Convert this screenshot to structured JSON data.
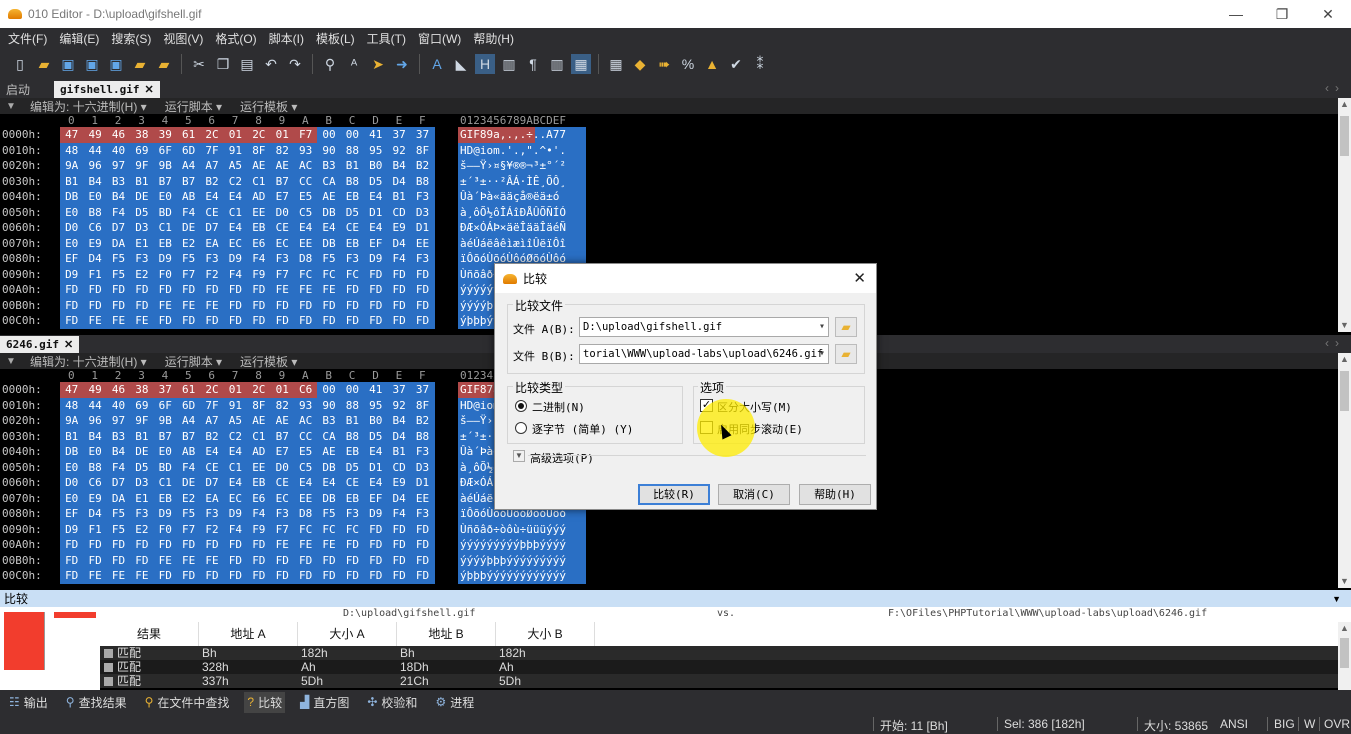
{
  "window": {
    "title": "010 Editor - D:\\upload\\gifshell.gif",
    "minimize": "—",
    "restore": "❐",
    "close": "✕"
  },
  "menu": [
    "文件(F)",
    "编辑(E)",
    "搜索(S)",
    "视图(V)",
    "格式(O)",
    "脚本(I)",
    "模板(L)",
    "工具(T)",
    "窗口(W)",
    "帮助(H)"
  ],
  "tabs_top": {
    "start": "启动",
    "file": "gifshell.gif",
    "close": "✕"
  },
  "tabs_bottom": {
    "file": "6246.gif",
    "close": "✕"
  },
  "editor_options": {
    "edit_as": "编辑为: 十六进制(H) ▾",
    "run_script": "运行脚本 ▾",
    "run_template": "运行模板 ▾"
  },
  "hex_header": {
    "columns": [
      "0",
      "1",
      "2",
      "3",
      "4",
      "5",
      "6",
      "7",
      "8",
      "9",
      "A",
      "B",
      "C",
      "D",
      "E",
      "F"
    ],
    "ascii": "0123456789ABCDEF"
  },
  "pane_a": {
    "lines": [
      {
        "offset": "0000h:",
        "bytes": [
          "47",
          "49",
          "46",
          "38",
          "39",
          "61",
          "2C",
          "01",
          "2C",
          "01",
          "F7",
          "00",
          "00",
          "41",
          "37",
          "37"
        ],
        "ascii": "GIF89a,.,.÷..A77"
      },
      {
        "offset": "0010h:",
        "bytes": [
          "48",
          "44",
          "40",
          "69",
          "6F",
          "6D",
          "7F",
          "91",
          "8F",
          "82",
          "93",
          "90",
          "88",
          "95",
          "92",
          "8F"
        ],
        "ascii": "HD@iom.'.,\".^•'."
      },
      {
        "offset": "0020h:",
        "bytes": [
          "9A",
          "96",
          "97",
          "9F",
          "9B",
          "A4",
          "A7",
          "A5",
          "AE",
          "AE",
          "AC",
          "B3",
          "B1",
          "B0",
          "B4",
          "B2"
        ],
        "ascii": "š–—Ÿ›¤§¥®®¬³±°´²"
      },
      {
        "offset": "0030h:",
        "bytes": [
          "B1",
          "B4",
          "B3",
          "B1",
          "B7",
          "B7",
          "B2",
          "C2",
          "C1",
          "B7",
          "CC",
          "CA",
          "B8",
          "D5",
          "D4",
          "B8"
        ],
        "ascii": "±´³±··²ÂÁ·ÌÊ¸ÕÔ¸"
      },
      {
        "offset": "0040h:",
        "bytes": [
          "DB",
          "E0",
          "B4",
          "DE",
          "E0",
          "AB",
          "E4",
          "E4",
          "AD",
          "E7",
          "E5",
          "AE",
          "EB",
          "E4",
          "B1",
          "F3"
        ],
        "ascii": "Ûà´Þà«ää­çå®ëä±ó"
      },
      {
        "offset": "0050h:",
        "bytes": [
          "E0",
          "B8",
          "F4",
          "D5",
          "BD",
          "F4",
          "CE",
          "C1",
          "EE",
          "D0",
          "C5",
          "DB",
          "D5",
          "D1",
          "CD",
          "D3"
        ],
        "ascii": "à¸ôÕ½ôÎÁîÐÅÛÕÑÍÓ"
      },
      {
        "offset": "0060h:",
        "bytes": [
          "D0",
          "C6",
          "D7",
          "D3",
          "C1",
          "DE",
          "D7",
          "E4",
          "EB",
          "CE",
          "E4",
          "E4",
          "CE",
          "E4",
          "E9",
          "D1"
        ],
        "ascii": "ÐÆ×ÓÁÞ×äëÎääÎäéÑ"
      },
      {
        "offset": "0070h:",
        "bytes": [
          "E0",
          "E9",
          "DA",
          "E1",
          "EB",
          "E2",
          "EA",
          "EC",
          "E6",
          "EC",
          "EE",
          "DB",
          "EB",
          "EF",
          "D4",
          "EE"
        ],
        "ascii": "àéÚáëâêìæìîÛëïÔî"
      },
      {
        "offset": "0080h:",
        "bytes": [
          "EF",
          "D4",
          "F5",
          "F3",
          "D9",
          "F5",
          "F3",
          "D9",
          "F4",
          "F3",
          "D8",
          "F5",
          "F3",
          "D9",
          "F4",
          "F3"
        ],
        "ascii": "ïÔõóÙõóÙôóØõóÙôó"
      },
      {
        "offset": "0090h:",
        "bytes": [
          "D9",
          "F1",
          "F5",
          "E2",
          "F0",
          "F7",
          "F2",
          "F4",
          "F9",
          "F7",
          "FC",
          "FC",
          "FC",
          "FD",
          "FD",
          "FD"
        ],
        "ascii": "Ùñõâð÷òôù÷üüüýýý"
      },
      {
        "offset": "00A0h:",
        "bytes": [
          "FD",
          "FD",
          "FD",
          "FD",
          "FD",
          "FD",
          "FD",
          "FD",
          "FD",
          "FE",
          "FE",
          "FE",
          "FD",
          "FD",
          "FD",
          "FD"
        ],
        "ascii": "ýýýýýýýýýþþþýýýý"
      },
      {
        "offset": "00B0h:",
        "bytes": [
          "FD",
          "FD",
          "FD",
          "FD",
          "FE",
          "FE",
          "FE",
          "FD",
          "FD",
          "FD",
          "FD",
          "FD",
          "FD",
          "FD",
          "FD",
          "FD"
        ],
        "ascii": "ýýýýþþþýýýýýýýýý"
      },
      {
        "offset": "00C0h:",
        "bytes": [
          "FD",
          "FE",
          "FE",
          "FE",
          "FD",
          "FD",
          "FD",
          "FD",
          "FD",
          "FD",
          "FD",
          "FD",
          "FD",
          "FD",
          "FD",
          "FD"
        ],
        "ascii": "ýþþþýýýýýýýýýýýý"
      }
    ]
  },
  "pane_b": {
    "lines": [
      {
        "offset": "0000h:",
        "bytes": [
          "47",
          "49",
          "46",
          "38",
          "37",
          "61",
          "2C",
          "01",
          "2C",
          "01",
          "C6",
          "00",
          "00",
          "41",
          "37",
          "37"
        ],
        "ascii": "GIF87a,.,.Æ..A77"
      },
      {
        "offset": "0010h:",
        "bytes": [
          "48",
          "44",
          "40",
          "69",
          "6F",
          "6D",
          "7F",
          "91",
          "8F",
          "82",
          "93",
          "90",
          "88",
          "95",
          "92",
          "8F"
        ],
        "ascii": "HD@iom.'.,\".^•'."
      },
      {
        "offset": "0020h:",
        "bytes": [
          "9A",
          "96",
          "97",
          "9F",
          "9B",
          "A4",
          "A7",
          "A5",
          "AE",
          "AE",
          "AC",
          "B3",
          "B1",
          "B0",
          "B4",
          "B2"
        ],
        "ascii": "š–—Ÿ›¤§¥®®¬³±°´²"
      },
      {
        "offset": "0030h:",
        "bytes": [
          "B1",
          "B4",
          "B3",
          "B1",
          "B7",
          "B7",
          "B2",
          "C2",
          "C1",
          "B7",
          "CC",
          "CA",
          "B8",
          "D5",
          "D4",
          "B8"
        ],
        "ascii": "±´³±··²ÂÁ·ÌÊ¸ÕÔ¸"
      },
      {
        "offset": "0040h:",
        "bytes": [
          "DB",
          "E0",
          "B4",
          "DE",
          "E0",
          "AB",
          "E4",
          "E4",
          "AD",
          "E7",
          "E5",
          "AE",
          "EB",
          "E4",
          "B1",
          "F3"
        ],
        "ascii": "Ûà´Þà«ää­çå®ëä±ó"
      },
      {
        "offset": "0050h:",
        "bytes": [
          "E0",
          "B8",
          "F4",
          "D5",
          "BD",
          "F4",
          "CE",
          "C1",
          "EE",
          "D0",
          "C5",
          "DB",
          "D5",
          "D1",
          "CD",
          "D3"
        ],
        "ascii": "à¸ôÕ½ôÎÁîÐÅÛÕÑÍÓ"
      },
      {
        "offset": "0060h:",
        "bytes": [
          "D0",
          "C6",
          "D7",
          "D3",
          "C1",
          "DE",
          "D7",
          "E4",
          "EB",
          "CE",
          "E4",
          "E4",
          "CE",
          "E4",
          "E9",
          "D1"
        ],
        "ascii": "ÐÆ×ÓÁÞ×äëÎääÎäéÑ"
      },
      {
        "offset": "0070h:",
        "bytes": [
          "E0",
          "E9",
          "DA",
          "E1",
          "EB",
          "E2",
          "EA",
          "EC",
          "E6",
          "EC",
          "EE",
          "DB",
          "EB",
          "EF",
          "D4",
          "EE"
        ],
        "ascii": "àéÚáëâêìæìîÛëïÔî"
      },
      {
        "offset": "0080h:",
        "bytes": [
          "EF",
          "D4",
          "F5",
          "F3",
          "D9",
          "F5",
          "F3",
          "D9",
          "F4",
          "F3",
          "D8",
          "F5",
          "F3",
          "D9",
          "F4",
          "F3"
        ],
        "ascii": "ïÔõóÙõóÙôóØõóÙôó"
      },
      {
        "offset": "0090h:",
        "bytes": [
          "D9",
          "F1",
          "F5",
          "E2",
          "F0",
          "F7",
          "F2",
          "F4",
          "F9",
          "F7",
          "FC",
          "FC",
          "FC",
          "FD",
          "FD",
          "FD"
        ],
        "ascii": "Ùñõâð÷òôù÷üüüýýý"
      },
      {
        "offset": "00A0h:",
        "bytes": [
          "FD",
          "FD",
          "FD",
          "FD",
          "FD",
          "FD",
          "FD",
          "FD",
          "FD",
          "FE",
          "FE",
          "FE",
          "FD",
          "FD",
          "FD",
          "FD"
        ],
        "ascii": "ýýýýýýýýýþþþýýýý"
      },
      {
        "offset": "00B0h:",
        "bytes": [
          "FD",
          "FD",
          "FD",
          "FD",
          "FE",
          "FE",
          "FE",
          "FD",
          "FD",
          "FD",
          "FD",
          "FD",
          "FD",
          "FD",
          "FD",
          "FD"
        ],
        "ascii": "ýýýýþþþýýýýýýýýý"
      },
      {
        "offset": "00C0h:",
        "bytes": [
          "FD",
          "FE",
          "FE",
          "FE",
          "FD",
          "FD",
          "FD",
          "FD",
          "FD",
          "FD",
          "FD",
          "FD",
          "FD",
          "FD",
          "FD",
          "FD"
        ],
        "ascii": "ýþþþýýýýýýýýýýýý"
      }
    ]
  },
  "compare_panel": {
    "title": "比较",
    "pin": "▼",
    "path_a": "D:\\upload\\gifshell.gif",
    "vs": "vs.",
    "path_b": "F:\\OFiles\\PHPTutorial\\WWW\\upload-labs\\upload\\6246.gif",
    "columns": [
      "结果",
      "地址 A",
      "大小 A",
      "地址 B",
      "大小 B"
    ],
    "rows": [
      [
        "匹配",
        "Bh",
        "182h",
        "Bh",
        "182h"
      ],
      [
        "匹配",
        "328h",
        "Ah",
        "18Dh",
        "Ah"
      ],
      [
        "匹配",
        "337h",
        "5Dh",
        "21Ch",
        "5Dh"
      ]
    ]
  },
  "bottom_tabs": [
    "输出",
    "查找结果",
    "在文件中查找",
    "比较",
    "直方图",
    "校验和",
    "进程"
  ],
  "status": {
    "start": "开始: 11 [Bh]",
    "sel": "Sel: 386 [182h]",
    "size": "大小: 53865",
    "encoding": "ANSI",
    "big": "BIG",
    "w": "W",
    "ovr": "OVR"
  },
  "dialog": {
    "title": "比较",
    "close": "✕",
    "group_files": "比较文件",
    "file_a_label": "文件 A(B):",
    "file_a_value": "D:\\upload\\gifshell.gif",
    "file_b_label": "文件 B(B):",
    "file_b_value": "torial\\WWW\\upload-labs\\upload\\6246.gif",
    "group_type": "比较类型",
    "type_binary": "二进制(N)",
    "type_bytewise": "逐字节 (简单) (Y)",
    "group_options": "选项",
    "opt_case": "区分大小写(M)",
    "opt_sync": "启用同步滚动(E)",
    "advanced": "高级选项(P)",
    "btn_compare": "比较(R)",
    "btn_cancel": "取消(C)",
    "btn_help": "帮助(H)"
  }
}
